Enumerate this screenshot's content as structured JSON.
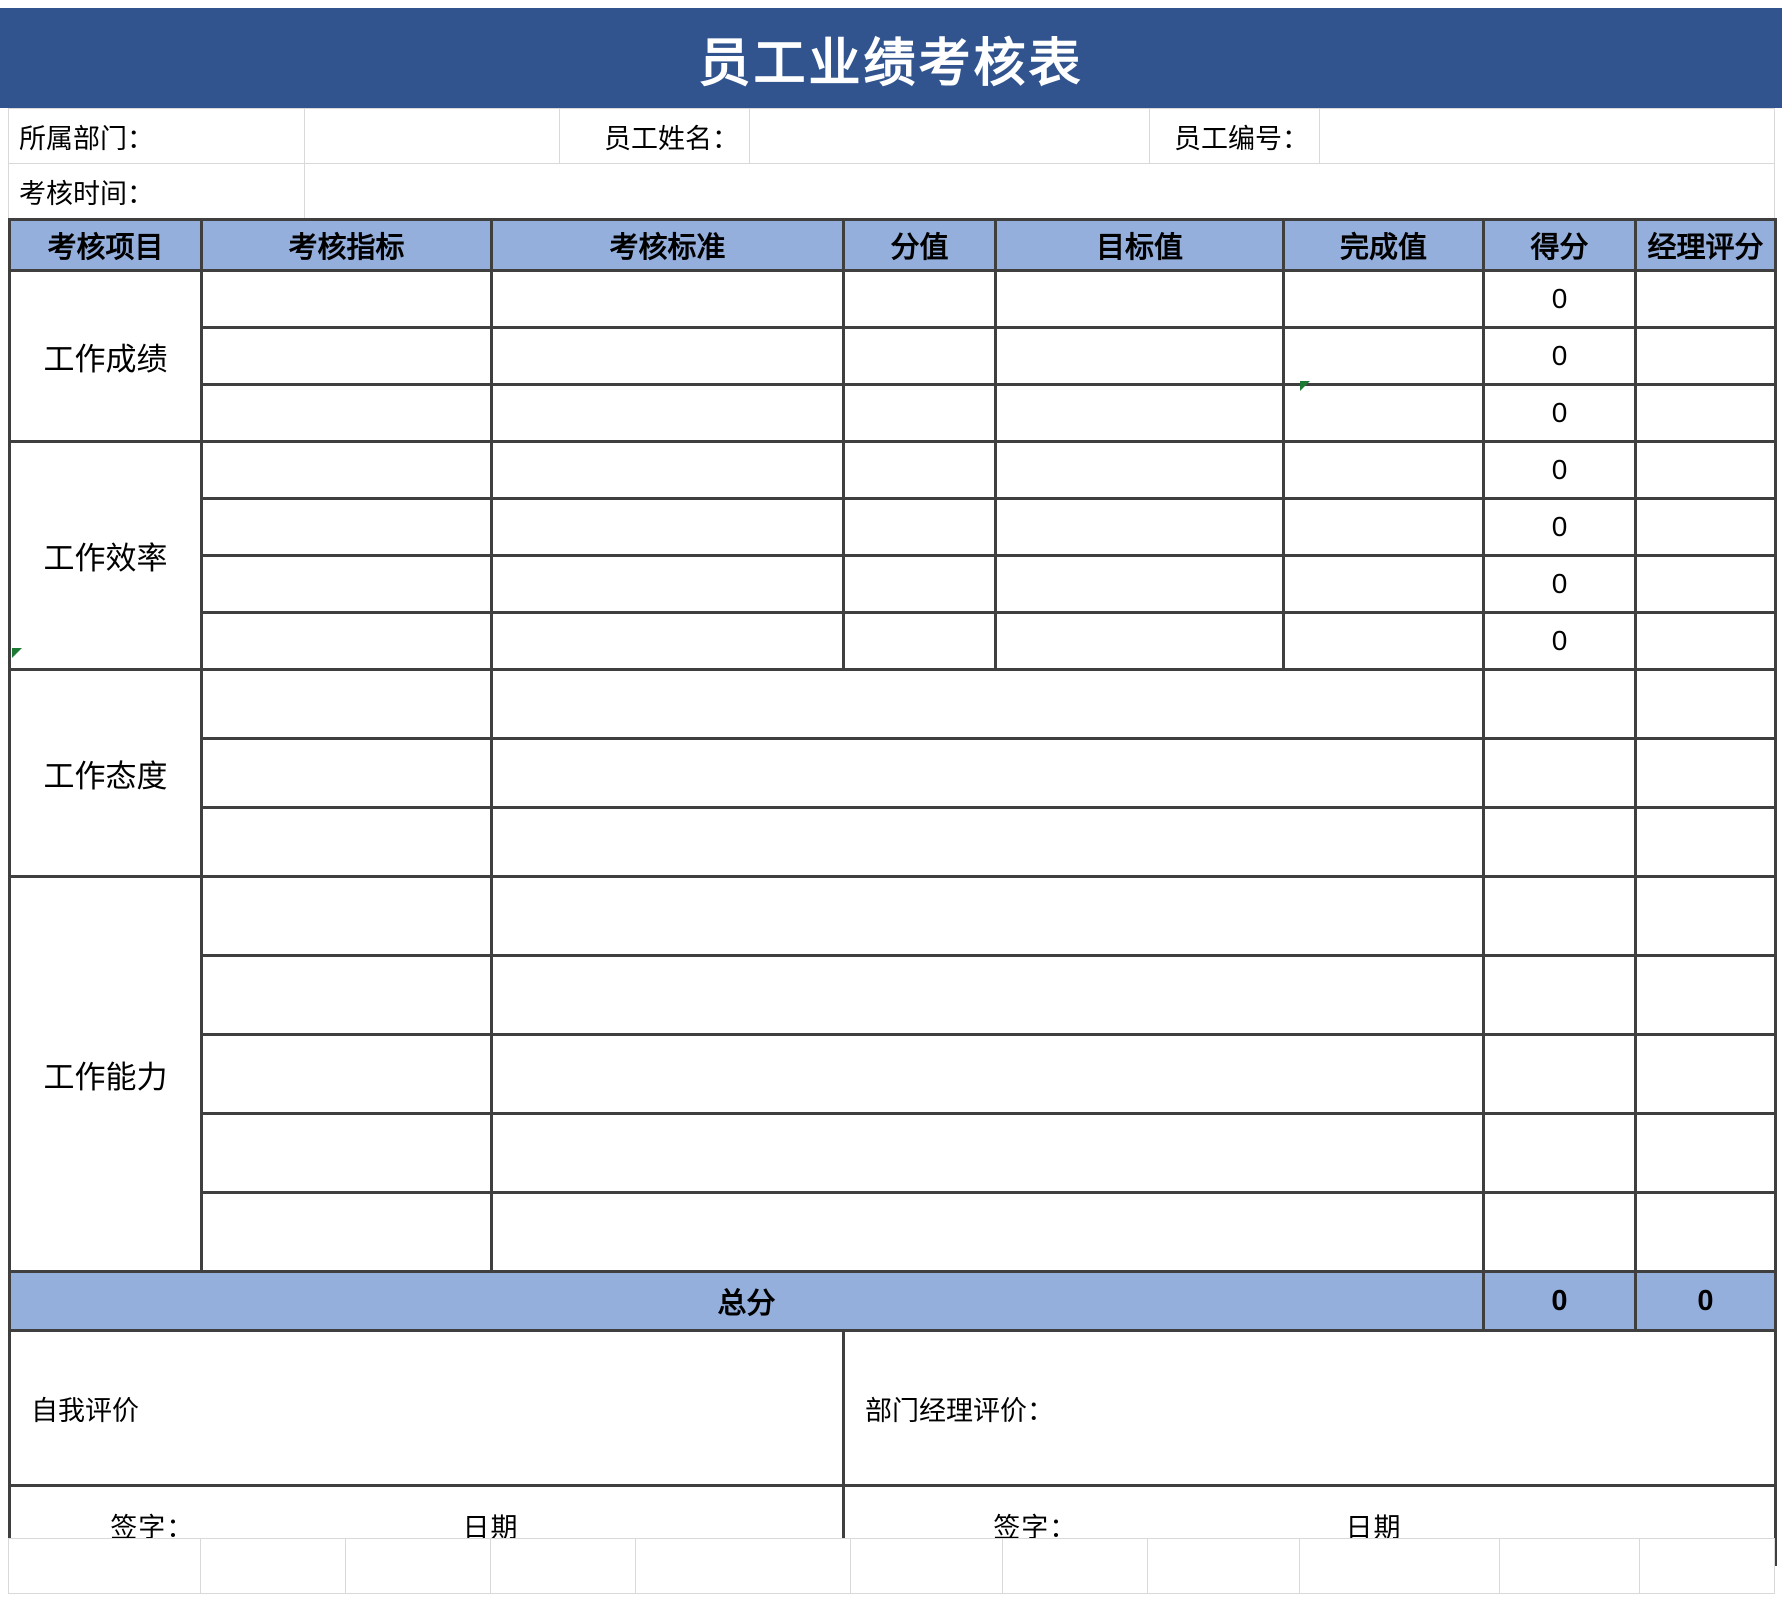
{
  "title": "员工业绩考核表",
  "theme": {
    "title_bar_color": "#31548f",
    "header_fill_color": "#95afdd",
    "grid_line_color": "#3f3f3f",
    "thin_grid_color": "#d9d9d9",
    "text_color": "#000000"
  },
  "info": {
    "department_label": "所属部门：",
    "department_value": "",
    "employee_name_label": "员工姓名：",
    "employee_name_value": "",
    "employee_id_label": "员工编号：",
    "employee_id_value": "",
    "period_label": "考核时间：",
    "period_value": ""
  },
  "table": {
    "headers": [
      "考核项目",
      "考核指标",
      "考核标准",
      "分值",
      "目标值",
      "完成值",
      "得分",
      "经理评分"
    ],
    "sections": [
      {
        "category": "工作成绩",
        "merged_middle": false,
        "rows": [
          {
            "indicator": "",
            "standard": "",
            "weight": "",
            "target": "",
            "actual": "",
            "score": "0",
            "manager_score": ""
          },
          {
            "indicator": "",
            "standard": "",
            "weight": "",
            "target": "",
            "actual": "",
            "score": "0",
            "manager_score": ""
          },
          {
            "indicator": "",
            "standard": "",
            "weight": "",
            "target": "",
            "actual": "",
            "score": "0",
            "manager_score": ""
          }
        ]
      },
      {
        "category": "工作效率",
        "merged_middle": false,
        "rows": [
          {
            "indicator": "",
            "standard": "",
            "weight": "",
            "target": "",
            "actual": "",
            "score": "0",
            "manager_score": ""
          },
          {
            "indicator": "",
            "standard": "",
            "weight": "",
            "target": "",
            "actual": "",
            "score": "0",
            "manager_score": ""
          },
          {
            "indicator": "",
            "standard": "",
            "weight": "",
            "target": "",
            "actual": "",
            "score": "0",
            "manager_score": ""
          },
          {
            "indicator": "",
            "standard": "",
            "weight": "",
            "target": "",
            "actual": "",
            "score": "0",
            "manager_score": ""
          }
        ]
      },
      {
        "category": "工作态度",
        "merged_middle": true,
        "rows": [
          {
            "indicator": "",
            "merged": "",
            "score": "",
            "manager_score": ""
          },
          {
            "indicator": "",
            "merged": "",
            "score": "",
            "manager_score": ""
          },
          {
            "indicator": "",
            "merged": "",
            "score": "",
            "manager_score": ""
          }
        ]
      },
      {
        "category": "工作能力",
        "merged_middle": true,
        "rows": [
          {
            "indicator": "",
            "merged": "",
            "score": "",
            "manager_score": ""
          },
          {
            "indicator": "",
            "merged": "",
            "score": "",
            "manager_score": ""
          },
          {
            "indicator": "",
            "merged": "",
            "score": "",
            "manager_score": ""
          },
          {
            "indicator": "",
            "merged": "",
            "score": "",
            "manager_score": ""
          },
          {
            "indicator": "",
            "merged": "",
            "score": "",
            "manager_score": ""
          }
        ]
      }
    ],
    "total": {
      "label": "总分",
      "score": "0",
      "manager_score": "0"
    }
  },
  "evaluation": {
    "self_label": "自我评价",
    "self_value": "",
    "manager_label": "部门经理评价：",
    "manager_value": "",
    "self_sign_label": "签字：",
    "self_sign_line": "______________",
    "self_date_label": "日期",
    "self_date_line": "______________",
    "manager_sign_label": "签字：",
    "manager_sign_line": "______________",
    "manager_date_label": "日期",
    "manager_date_line": "______________"
  }
}
